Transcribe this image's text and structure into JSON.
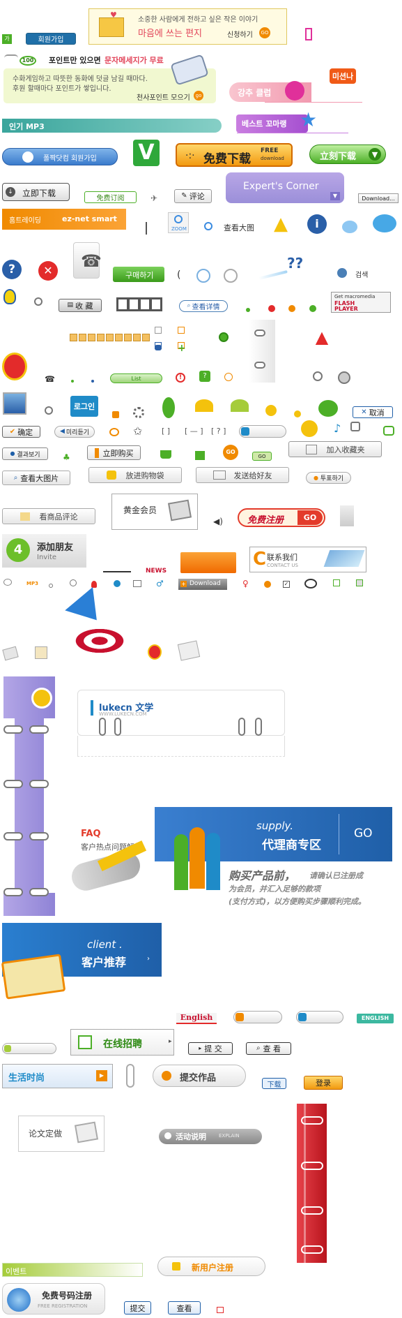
{
  "row1": {
    "letter_top": "소중한 사람에게 전하고 싶은 작은 이야기",
    "letter_title": "마음에 쓰는 편지",
    "letter_apply": "신청하기",
    "go": "GO",
    "join_btn": "회원가입"
  },
  "sms": {
    "line1a": "포인트만 있으면",
    "line1b": "문자메세지가 무료",
    "body1": "수화게임하고 따뜻한 동화에 덧글 남길 때마다.",
    "body2": "후원 할때마다 포인트가 쌓입니다.",
    "link": "천사포인트 모으기",
    "badge": "100"
  },
  "korean_tabs": {
    "mission": "미션나",
    "gangju": "강추 클럽",
    "inki_mp3": "인기 MP3",
    "best": "베스트 꼬마랭"
  },
  "download_row": {
    "poltong_join": "폴짝닷컴 회원가입",
    "free_download": "免费下载",
    "free_download_en1": "FREE",
    "free_download_en2": "download",
    "ligo_download": "立刻下载",
    "immediate_download": "立即下载",
    "free_subscribe": "免费订阅",
    "comment": "评论",
    "experts_corner": "Expert's Corner",
    "download_small": "Download...",
    "hotrade": "홈트레이딩",
    "eznet": "ez-net smart",
    "zoom": "ZOOM",
    "view_large": "查看大图"
  },
  "row_icons": {
    "buy": "구매하기",
    "search_kr": "검색",
    "collect": "收 藏",
    "view_detail": "查看详情",
    "flash_get": "Get macromedia",
    "flash_player": "FLASH PLAYER"
  },
  "row_login": {
    "login": "로그인",
    "cancel": "取消",
    "confirm": "确定",
    "preview": "미리듣기",
    "list_btn": "List",
    "bracket1": "[ ]",
    "bracket2": "[ — ]",
    "bracket3": "[ ? ]"
  },
  "row_results": {
    "result": "결과보기",
    "buy_now": "立即购买",
    "go": "GO",
    "add_fav": "加入收藏夹",
    "view_large2": "查看大图片",
    "put_cart": "放进购物袋",
    "send_friend": "发送给好友",
    "vote": "투표하기",
    "view_comment": "看商品评论",
    "gold_member": "黄金会员",
    "free_register": "免费注册",
    "reg_go": "GO"
  },
  "row_friends": {
    "add_friend": "添加朋友",
    "invite": "Invite",
    "news": "NEWS",
    "contact": "联系我们",
    "contact_en": "CONTACT US",
    "download": "Download",
    "mp3": "MP3",
    "num4": "4"
  },
  "middle": {
    "lukecn": "lukecn 文学",
    "lukecn_url": "WWW.LUKECN.COM",
    "faq": "FAQ",
    "faq_sub": "客户热点问题解答",
    "supply_en": "supply.",
    "supply_cn": "代理商专区",
    "supply_go": "GO",
    "buy_before": "购买产品前，",
    "buy_text1": "请确认已注册成",
    "buy_text2": "为会员，并汇入足够的款项",
    "buy_text3": "(支付方式)，以方便购买步骤顺利完成。",
    "client_en": "client .",
    "client_cn": "客户推荐"
  },
  "bottom": {
    "english": "English",
    "english_btn": "ENGLISH",
    "job": "在线招聘",
    "submit": "提 交",
    "query": "查 看",
    "life": "生活时尚",
    "submit_work": "提交作品",
    "download": "下载",
    "login": "登录",
    "thesis": "论文定做",
    "activity": "活动说明",
    "explain": "EXPLAIN",
    "event": "이벤트",
    "new_user_reg": "新用户注册",
    "free_num_reg": "免费号码注册",
    "free_reg_en": "FREE REGISTRATION",
    "submit2": "提交",
    "query2": "查看"
  },
  "colors": {
    "orange": "#f08a00",
    "blue_panel": "#1f5fa8",
    "purple": "#9b8fd9",
    "red_strip": "#d6202a",
    "green": "#4caf27"
  }
}
